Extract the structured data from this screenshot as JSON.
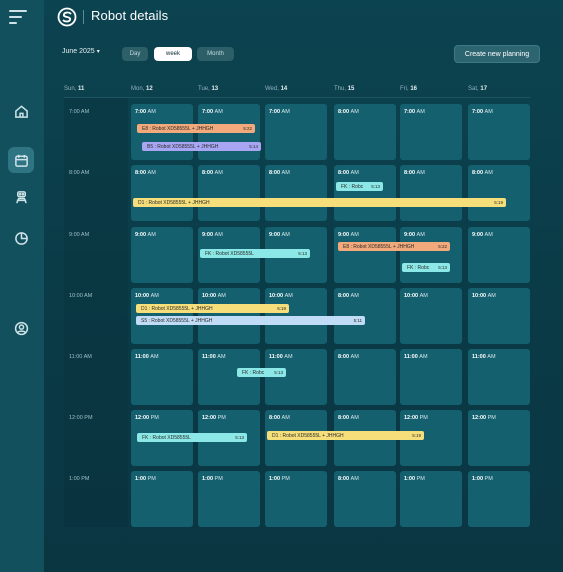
{
  "header": {
    "title": "Robot details"
  },
  "toolbar": {
    "month": "June 2025",
    "views": [
      "Day",
      "week",
      "Month"
    ],
    "active_view": "week",
    "create_label": "Create new planning"
  },
  "days": [
    {
      "name": "Sun,",
      "num": "11"
    },
    {
      "name": "Mon,",
      "num": "12"
    },
    {
      "name": "Tue,",
      "num": "13"
    },
    {
      "name": "Wed,",
      "num": "14"
    },
    {
      "name": "Thu,",
      "num": "15"
    },
    {
      "name": "Fri,",
      "num": "16"
    },
    {
      "name": "Sat,",
      "num": "17"
    }
  ],
  "times": [
    "7:00 AM",
    "8:00 AM",
    "9:00 AM",
    "10:00 AM",
    "11:00 AM",
    "12:00 PM",
    "1:00 PM"
  ],
  "cell_times": [
    [
      [
        "7:00",
        "AM"
      ],
      [
        "7:00",
        "AM"
      ],
      [
        "7:00",
        "AM"
      ],
      [
        "8:00",
        "AM"
      ],
      [
        "7:00",
        "AM"
      ],
      [
        "7:00",
        "AM"
      ]
    ],
    [
      [
        "8:00",
        "AM"
      ],
      [
        "8:00",
        "AM"
      ],
      [
        "8:00",
        "AM"
      ],
      [
        "8:00",
        "AM"
      ],
      [
        "8:00",
        "AM"
      ],
      [
        "8:00",
        "AM"
      ]
    ],
    [
      [
        "9:00",
        "AM"
      ],
      [
        "9:00",
        "AM"
      ],
      [
        "9:00",
        "AM"
      ],
      [
        "9:00",
        "AM"
      ],
      [
        "9:00",
        "AM"
      ],
      [
        "9:00",
        "AM"
      ]
    ],
    [
      [
        "10:00",
        "AM"
      ],
      [
        "10:00",
        "AM"
      ],
      [
        "10:00",
        "AM"
      ],
      [
        "8:00",
        "AM"
      ],
      [
        "10:00",
        "AM"
      ],
      [
        "10:00",
        "AM"
      ]
    ],
    [
      [
        "11:00",
        "AM"
      ],
      [
        "11:00",
        "AM"
      ],
      [
        "11:00",
        "AM"
      ],
      [
        "8:00",
        "AM"
      ],
      [
        "11:00",
        "AM"
      ],
      [
        "11:00",
        "AM"
      ]
    ],
    [
      [
        "12:00",
        "PM"
      ],
      [
        "12:00",
        "PM"
      ],
      [
        "8:00",
        "AM"
      ],
      [
        "8:00",
        "AM"
      ],
      [
        "12:00",
        "PM"
      ],
      [
        "12:00",
        "PM"
      ]
    ],
    [
      [
        "1:00",
        "PM"
      ],
      [
        "1:00",
        "PM"
      ],
      [
        "1:00",
        "PM"
      ],
      [
        "8:00",
        "AM"
      ],
      [
        "1:00",
        "PM"
      ],
      [
        "1:00",
        "PM"
      ]
    ]
  ],
  "events": [
    {
      "label": "E8 : Robot XD58555L + JHHGH",
      "time": "5:22",
      "color": "orange"
    },
    {
      "label": "B5 : Robot XD58555L + JHHGH",
      "time": "5:14",
      "color": "purple"
    },
    {
      "label": "FK : Robc",
      "time": "5:13",
      "color": "cyan"
    },
    {
      "label": "D1 : Robot XD58555L + JHHGH",
      "time": "5:19",
      "color": "yellow"
    },
    {
      "label": "FK : Robot XD58555L",
      "time": "5:13",
      "color": "cyan"
    },
    {
      "label": "E8 : Robot XD58555L + JHHGH",
      "time": "5:22",
      "color": "orange"
    },
    {
      "label": "FK : Robc",
      "time": "5:13",
      "color": "cyan"
    },
    {
      "label": "D1 : Robot XD58555L + JHHGH",
      "time": "5:19",
      "color": "yellow"
    },
    {
      "label": "S5 : Robot XD58555L + JHHGH",
      "time": "5:11",
      "color": "blue"
    },
    {
      "label": "FK : Robc",
      "time": "5:13",
      "color": "cyan"
    },
    {
      "label": "FK : Robot XD58555L",
      "time": "5:13",
      "color": "cyan"
    },
    {
      "label": "D1 : Robot XD58555L + JHHGH",
      "time": "5:19",
      "color": "yellow"
    }
  ],
  "sidebar": {
    "items": [
      {
        "icon": "home-icon"
      },
      {
        "icon": "calendar-icon",
        "active": true
      },
      {
        "icon": "robot-icon"
      },
      {
        "icon": "pie-chart-icon"
      },
      {
        "icon": "user-icon"
      }
    ]
  },
  "colors": {
    "background": "#0a3b47",
    "cell": "#14606f",
    "sidebar": "#13505d",
    "accent": "#2c6470"
  }
}
